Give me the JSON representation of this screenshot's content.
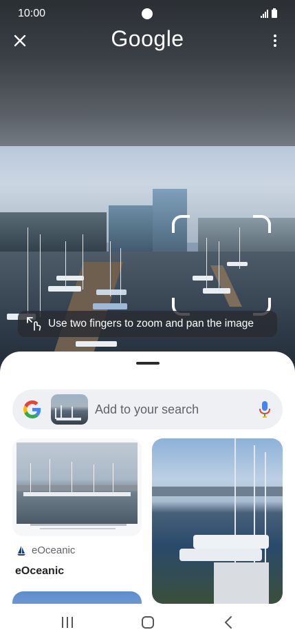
{
  "status_bar": {
    "time": "10:00"
  },
  "app_bar": {
    "logo_text": "Google"
  },
  "viewer": {
    "tooltip_text": "Use two fingers to zoom and pan the image"
  },
  "search": {
    "placeholder": "Add to your search"
  },
  "results": [
    {
      "source": "eOceanic",
      "title": "eOceanic"
    }
  ],
  "colors": {
    "google_blue": "#4285F4",
    "google_red": "#EA4335",
    "google_yellow": "#FBBC05",
    "google_green": "#34A853"
  },
  "icons": [
    "close-icon",
    "more-vert-icon",
    "zoom-gesture-icon",
    "google-g-icon",
    "mic-icon",
    "sailboat-icon",
    "recents-icon",
    "home-icon",
    "back-icon"
  ]
}
